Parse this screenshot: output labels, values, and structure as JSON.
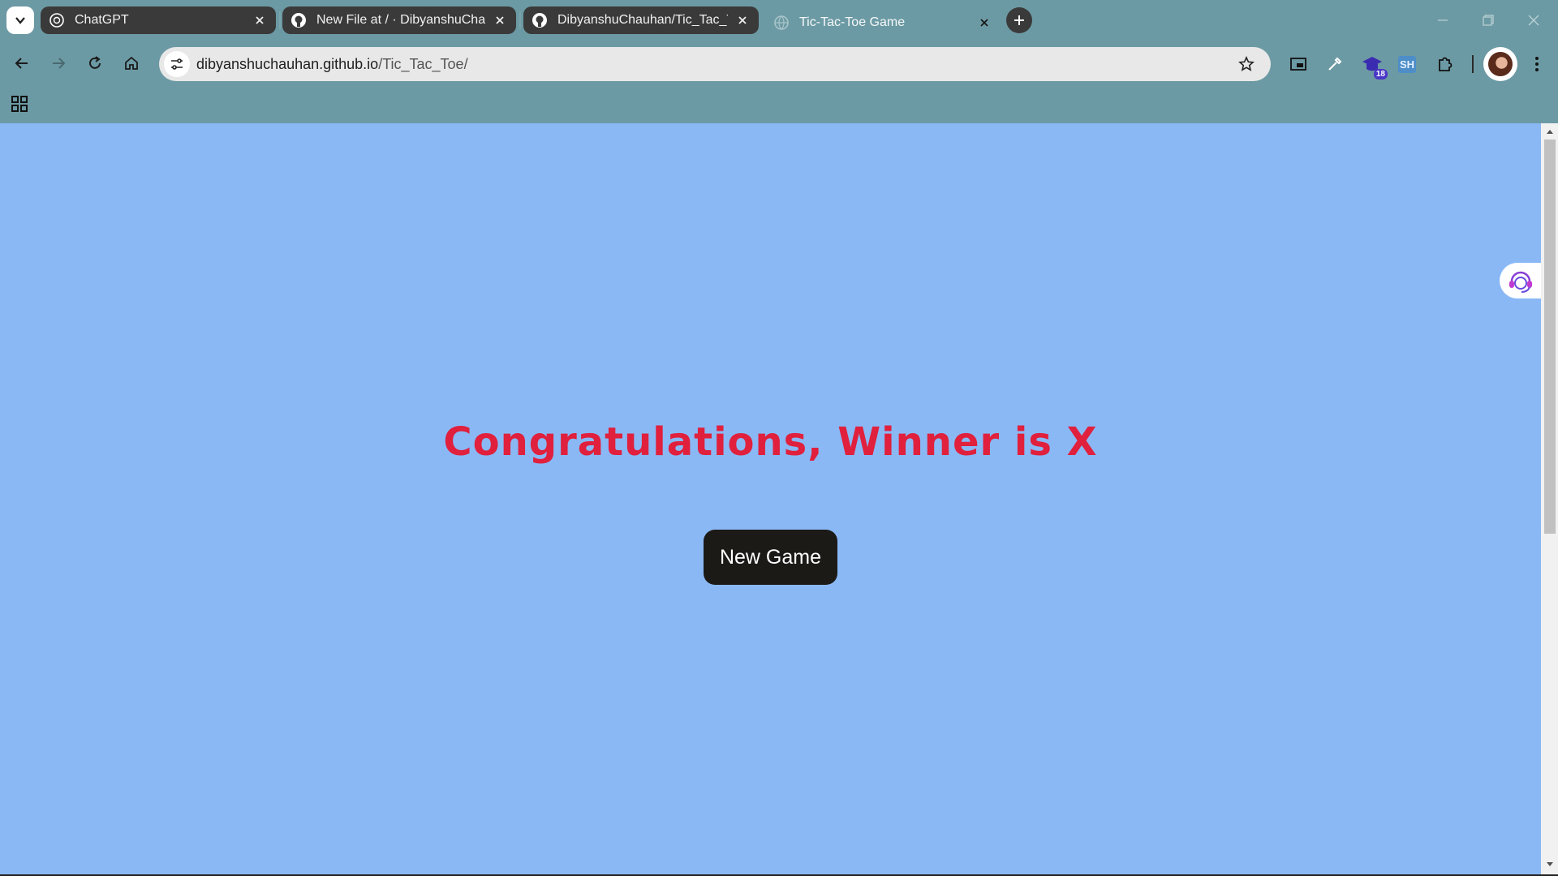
{
  "browser": {
    "tabs": [
      {
        "title": "ChatGPT",
        "favicon": "chatgpt-icon",
        "active": false
      },
      {
        "title": "New File at / · DibyanshuChauhan",
        "favicon": "github-icon",
        "active": false
      },
      {
        "title": "DibyanshuChauhan/Tic_Tac_Toe",
        "favicon": "github-icon",
        "active": false
      },
      {
        "title": "Tic-Tac-Toe Game",
        "favicon": "globe-icon",
        "active": true
      }
    ],
    "address": {
      "domain": "dibyanshuchauhan.github.io",
      "path": "/Tic_Tac_Toe/"
    },
    "extensions": {
      "badge_count": "18",
      "sh_label": "SH"
    }
  },
  "page": {
    "winner_message": "Congratulations, Winner is X",
    "new_game_label": "New Game"
  },
  "colors": {
    "page_background": "#8ab8f5",
    "winner_text": "#e0203c",
    "button_background": "#1c1a17",
    "chrome": "#6c9aa4"
  }
}
